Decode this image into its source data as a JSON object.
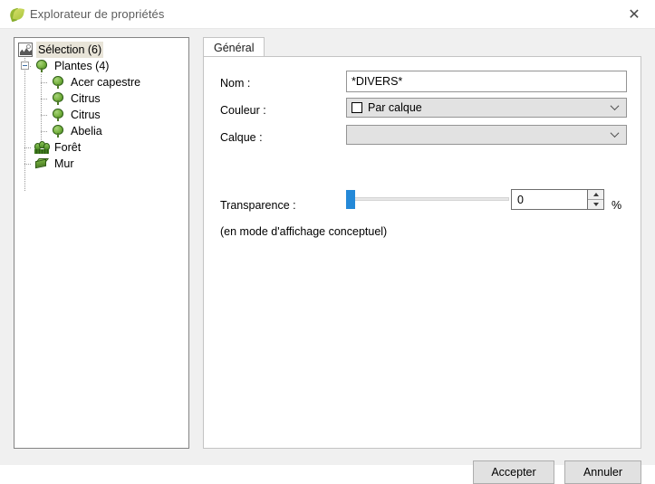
{
  "window": {
    "title": "Explorateur de propriétés",
    "icon": "leaf-icon",
    "close_label": "✕"
  },
  "tree": {
    "nodes": [
      {
        "label": "Sélection (6)",
        "icon": "selection-icon",
        "level": 1,
        "selected": true,
        "expander": null
      },
      {
        "label": "Plantes (4)",
        "icon": "plant-icon",
        "level": 2,
        "selected": false,
        "expander": "minus"
      },
      {
        "label": "Acer capestre",
        "icon": "plant-icon",
        "level": 3,
        "selected": false,
        "expander": null
      },
      {
        "label": "Citrus",
        "icon": "plant-icon",
        "level": 3,
        "selected": false,
        "expander": null
      },
      {
        "label": "Citrus",
        "icon": "plant-icon",
        "level": 3,
        "selected": false,
        "expander": null
      },
      {
        "label": "Abelia",
        "icon": "plant-icon",
        "level": 3,
        "selected": false,
        "expander": null
      },
      {
        "label": "Forêt",
        "icon": "forest-icon",
        "level": 2,
        "selected": false,
        "expander": null
      },
      {
        "label": "Mur",
        "icon": "wall-icon",
        "level": 2,
        "selected": false,
        "expander": null
      }
    ]
  },
  "tabs": {
    "items": [
      {
        "label": "Général",
        "selected": true
      }
    ]
  },
  "form": {
    "name": {
      "label": "Nom :",
      "value": "*DIVERS*",
      "placeholder": ""
    },
    "color": {
      "label": "Couleur :",
      "value": "Par calque",
      "swatch_color": "#ffffff"
    },
    "layer": {
      "label": "Calque :",
      "value": ""
    },
    "transparency": {
      "label": "Transparence :",
      "value": "0",
      "unit": "%",
      "min": 0,
      "max": 100,
      "hint": "(en mode d'affichage conceptuel)"
    }
  },
  "footer": {
    "accept_label": "Accepter",
    "cancel_label": "Annuler"
  },
  "colors": {
    "accent": "#2489d8",
    "selection_highlight": "#e8e4d8",
    "dialog_bg": "#f0f0f0",
    "field_disabled": "#e2e2e2"
  }
}
